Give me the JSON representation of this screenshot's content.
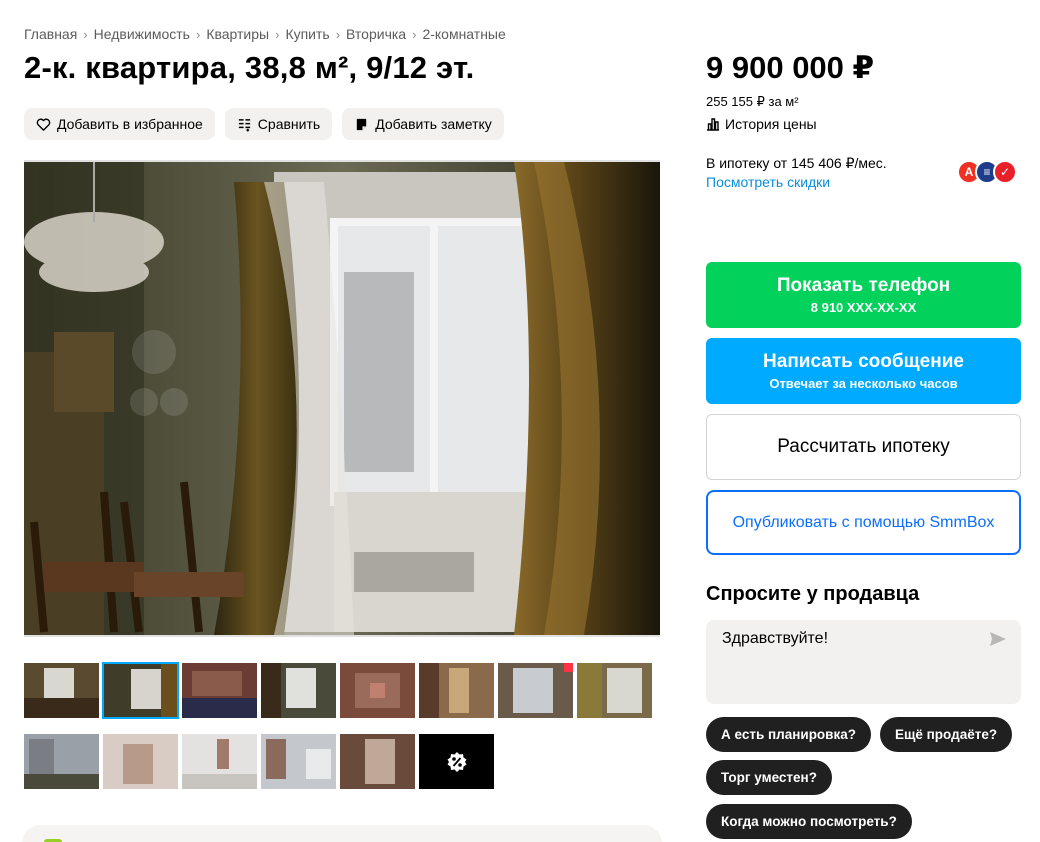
{
  "breadcrumbs": [
    "Главная",
    "Недвижимость",
    "Квартиры",
    "Купить",
    "Вторичка",
    "2-комнатные"
  ],
  "listing": {
    "title": "2-к. квартира, 38,8 м², 9/12 эт."
  },
  "actions": {
    "favorite": "Добавить в избранное",
    "compare": "Сравнить",
    "note": "Добавить заметку"
  },
  "gallery": {
    "thumbnail_count": 15,
    "selected_index": 1
  },
  "price": {
    "total": "9 900 000 ₽",
    "per_sqm": "255 155 ₽ за м²",
    "history_link": "История цены"
  },
  "mortgage": {
    "text": "В ипотеку от 145 406 ₽/мес.",
    "discounts_link": "Посмотреть скидки",
    "bank_icons": [
      "alfa-bank-icon",
      "bank-icon",
      "sovcombank-icon"
    ]
  },
  "contact": {
    "phone_label": "Показать телефон",
    "phone_number": "8 910 XXX-XX-XX",
    "message_label": "Написать сообщение",
    "message_sub": "Отвечает за несколько часов",
    "mortgage_calc": "Рассчитать ипотеку",
    "smmbox": "Опубликовать с помощью SmmBox"
  },
  "ask_seller": {
    "title": "Спросите у продавца",
    "input_value": "Здравствуйте!",
    "chips": [
      "А есть планировка?",
      "Ещё продаёте?",
      "Торг уместен?",
      "Когда можно посмотреть?"
    ]
  },
  "colors": {
    "green": "#02d15c",
    "blue": "#00aaff",
    "link": "#0a8dd8",
    "smmbox": "#0d6efd",
    "chip": "#202020"
  }
}
